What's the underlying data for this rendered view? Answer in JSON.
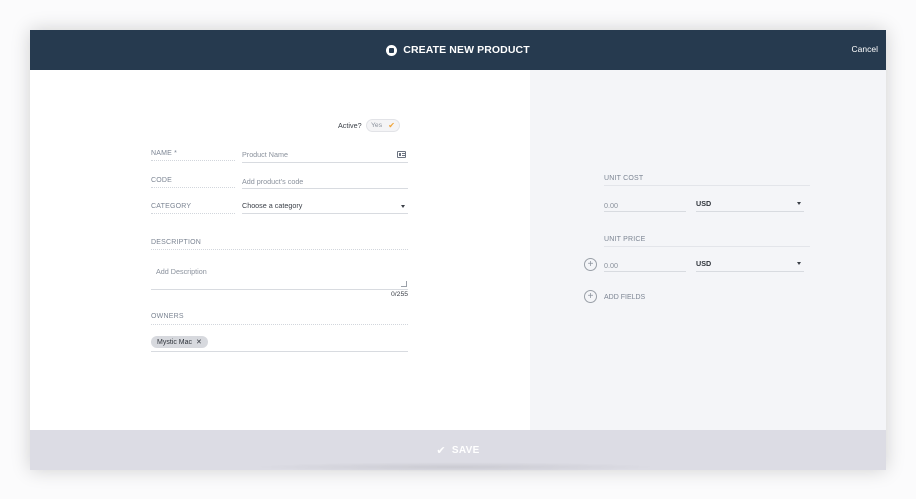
{
  "header": {
    "title": "CREATE NEW PRODUCT",
    "cancel_label": "Cancel"
  },
  "active": {
    "label": "Active?",
    "toggle_value": "Yes"
  },
  "fields": {
    "name": {
      "label": "NAME *",
      "placeholder": "Product Name"
    },
    "code": {
      "label": "CODE",
      "placeholder": "Add product's code"
    },
    "category": {
      "label": "CATEGORY",
      "selected": "Choose a category"
    },
    "description": {
      "label": "DESCRIPTION",
      "placeholder": "Add Description",
      "counter": "0/255"
    },
    "owners": {
      "label": "OWNERS",
      "chips": [
        "Mystic Mac"
      ]
    }
  },
  "pricing": {
    "unit_cost": {
      "label": "UNIT COST",
      "placeholder": "0.00",
      "currency": "USD"
    },
    "unit_price": {
      "label": "UNIT PRICE",
      "placeholder": "0.00",
      "currency": "USD"
    },
    "add_fields_label": "ADD FIELDS"
  },
  "footer": {
    "save_label": "SAVE"
  },
  "colors": {
    "header_bg": "#263a4f",
    "footer_bg": "#dcdce4",
    "right_panel_bg": "#f4f5f8",
    "toggle_check": "#f0a53a"
  },
  "icons": {
    "title_icon": "product-icon",
    "name_icon": "card-icon",
    "save_icon": "check-icon",
    "add_icon": "plus-circle-icon"
  }
}
